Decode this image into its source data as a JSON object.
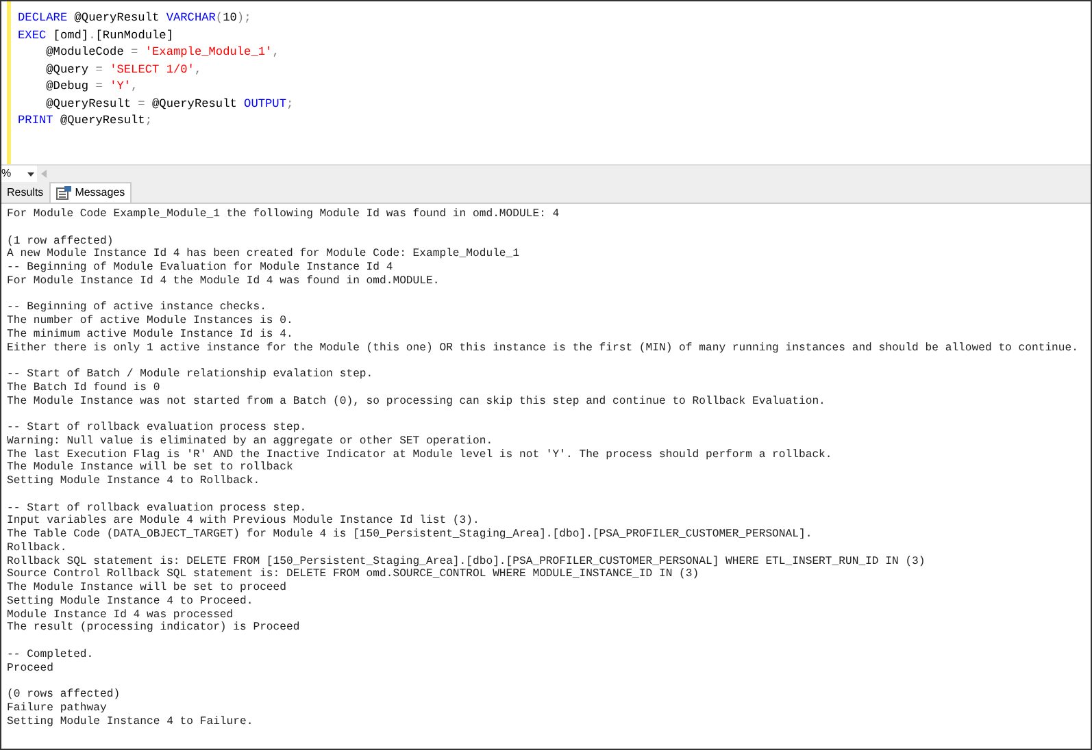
{
  "editor": {
    "lines": [
      [
        {
          "kind": "keyword",
          "text": "DECLARE"
        },
        {
          "kind": "plain",
          "text": " @QueryResult "
        },
        {
          "kind": "keyword",
          "text": "VARCHAR"
        },
        {
          "kind": "operator",
          "text": "("
        },
        {
          "kind": "plain",
          "text": "10"
        },
        {
          "kind": "operator",
          "text": ");"
        }
      ],
      [
        {
          "kind": "keyword",
          "text": "EXEC"
        },
        {
          "kind": "plain",
          "text": " [omd]"
        },
        {
          "kind": "operator",
          "text": "."
        },
        {
          "kind": "plain",
          "text": "[RunModule]"
        }
      ],
      [
        {
          "kind": "plain",
          "text": "    @ModuleCode "
        },
        {
          "kind": "operator",
          "text": "="
        },
        {
          "kind": "string",
          "text": " 'Example_Module_1'"
        },
        {
          "kind": "operator",
          "text": ","
        }
      ],
      [
        {
          "kind": "plain",
          "text": "    @Query "
        },
        {
          "kind": "operator",
          "text": "="
        },
        {
          "kind": "string",
          "text": " 'SELECT 1/0'"
        },
        {
          "kind": "operator",
          "text": ","
        }
      ],
      [
        {
          "kind": "plain",
          "text": "    @Debug "
        },
        {
          "kind": "operator",
          "text": "="
        },
        {
          "kind": "string",
          "text": " 'Y'"
        },
        {
          "kind": "operator",
          "text": ","
        }
      ],
      [
        {
          "kind": "plain",
          "text": "    @QueryResult "
        },
        {
          "kind": "operator",
          "text": "="
        },
        {
          "kind": "plain",
          "text": " @QueryResult "
        },
        {
          "kind": "keyword",
          "text": "OUTPUT"
        },
        {
          "kind": "operator",
          "text": ";"
        }
      ],
      [
        {
          "kind": "keyword",
          "text": "PRINT"
        },
        {
          "kind": "plain",
          "text": " @QueryResult"
        },
        {
          "kind": "operator",
          "text": ";"
        }
      ]
    ]
  },
  "zoom": {
    "value": "%"
  },
  "tabs": [
    {
      "label": "Results",
      "selected": false,
      "kind": "grid"
    },
    {
      "label": "Messages",
      "selected": true,
      "kind": "messages"
    }
  ],
  "messages": [
    [
      "For Module Code Example_Module_1 the following Module Id was found in omd.MODULE: 4"
    ],
    [
      "(1 row affected)",
      "A new Module Instance Id 4 has been created for Module Code: Example_Module_1",
      "-- Beginning of Module Evaluation for Module Instance Id 4",
      "For Module Instance Id 4 the Module Id 4 was found in omd.MODULE."
    ],
    [
      "-- Beginning of active instance checks.",
      "The number of active Module Instances is 0.",
      "The minimum active Module Instance Id is 4.",
      "Either there is only 1 active instance for the Module (this one) OR this instance is the first (MIN) of many running instances and should be allowed to continue."
    ],
    [
      "-- Start of Batch / Module relationship evalation step.",
      "The Batch Id found is 0",
      "The Module Instance was not started from a Batch (0), so processing can skip this step and continue to Rollback Evaluation."
    ],
    [
      "-- Start of rollback evaluation process step.",
      "Warning: Null value is eliminated by an aggregate or other SET operation.",
      "The last Execution Flag is 'R' AND the Inactive Indicator at Module level is not 'Y'. The process should perform a rollback.",
      "The Module Instance will be set to rollback",
      "Setting Module Instance 4 to Rollback."
    ],
    [
      "-- Start of rollback evaluation process step.",
      "Input variables are Module 4 with Previous Module Instance Id list (3).",
      "The Table Code (DATA_OBJECT_TARGET) for Module 4 is [150_Persistent_Staging_Area].[dbo].[PSA_PROFILER_CUSTOMER_PERSONAL].",
      "Rollback.",
      "Rollback SQL statement is: DELETE FROM [150_Persistent_Staging_Area].[dbo].[PSA_PROFILER_CUSTOMER_PERSONAL] WHERE ETL_INSERT_RUN_ID IN (3)",
      "Source Control Rollback SQL statement is: DELETE FROM omd.SOURCE_CONTROL WHERE MODULE_INSTANCE_ID IN (3)",
      "The Module Instance will be set to proceed",
      "Setting Module Instance 4 to Proceed.",
      "Module Instance Id 4 was processed",
      "The result (processing indicator) is Proceed"
    ],
    [
      "-- Completed.",
      "Proceed"
    ],
    [
      "(0 rows affected)",
      "Failure pathway",
      "Setting Module Instance 4 to Failure."
    ]
  ]
}
